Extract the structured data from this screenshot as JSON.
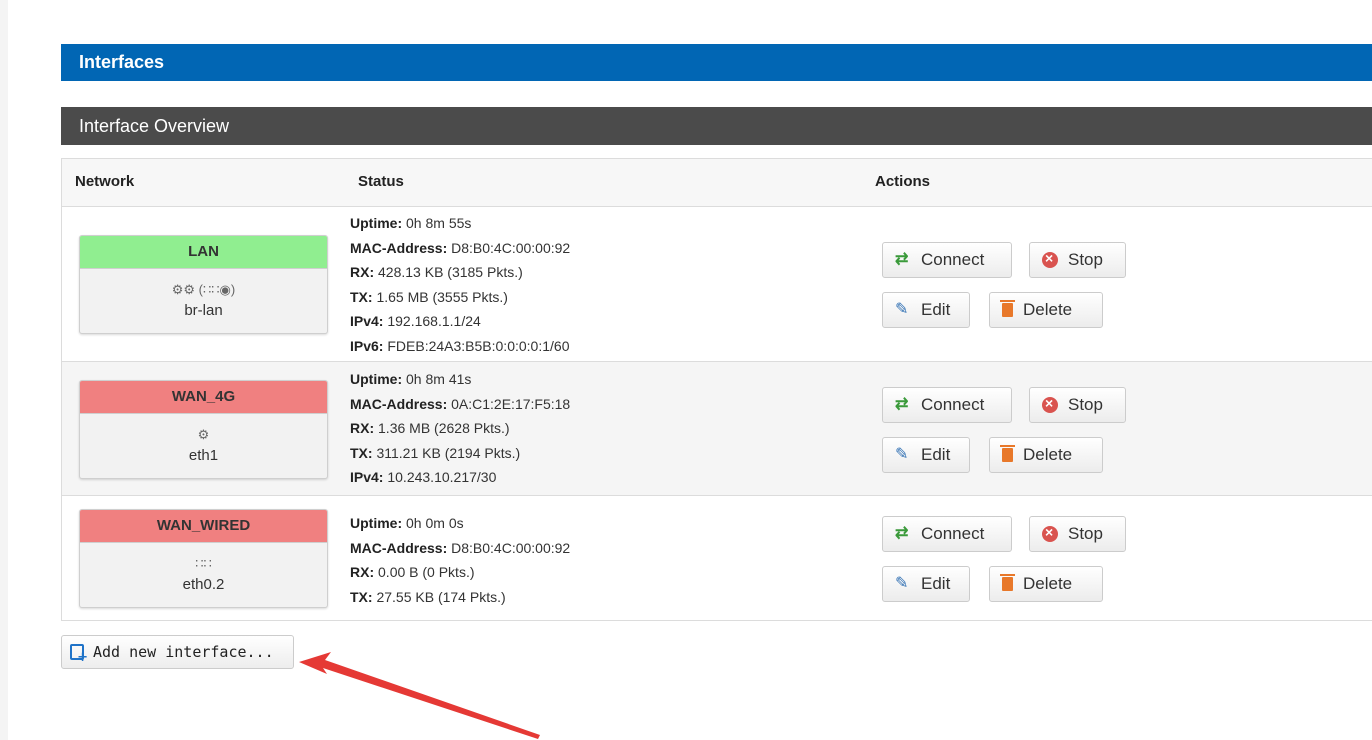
{
  "page": {
    "title": "Interfaces"
  },
  "section": {
    "title": "Interface Overview"
  },
  "table": {
    "headers": {
      "network": "Network",
      "status": "Status",
      "actions": "Actions"
    },
    "rows": [
      {
        "name": "LAN",
        "state": "up",
        "icons": "⚙⚙ (∷∷◉)",
        "device": "br-lan",
        "status": [
          {
            "label": "Uptime:",
            "value": " 0h 8m 55s"
          },
          {
            "label": "MAC-Address:",
            "value": " D8:B0:4C:00:00:92"
          },
          {
            "label": "RX:",
            "value": " 428.13 KB (3185 Pkts.)"
          },
          {
            "label": "TX:",
            "value": " 1.65 MB (3555 Pkts.)"
          },
          {
            "label": "IPv4:",
            "value": " 192.168.1.1/24"
          },
          {
            "label": "IPv6:",
            "value": " FDEB:24A3:B5B:0:0:0:0:1/60"
          }
        ]
      },
      {
        "name": "WAN_4G",
        "state": "down",
        "icons": "⚙",
        "device": "eth1",
        "status": [
          {
            "label": "Uptime:",
            "value": " 0h 8m 41s"
          },
          {
            "label": "MAC-Address:",
            "value": " 0A:C1:2E:17:F5:18"
          },
          {
            "label": "RX:",
            "value": " 1.36 MB (2628 Pkts.)"
          },
          {
            "label": "TX:",
            "value": " 311.21 KB (2194 Pkts.)"
          },
          {
            "label": "IPv4:",
            "value": " 10.243.10.217/30"
          }
        ]
      },
      {
        "name": "WAN_WIRED",
        "state": "down",
        "icons": "∷∷",
        "device": "eth0.2",
        "status": [
          {
            "label": "Uptime:",
            "value": " 0h 0m 0s"
          },
          {
            "label": "MAC-Address:",
            "value": " D8:B0:4C:00:00:92"
          },
          {
            "label": "RX:",
            "value": " 0.00 B (0 Pkts.)"
          },
          {
            "label": "TX:",
            "value": " 27.55 KB (174 Pkts.)"
          }
        ]
      }
    ]
  },
  "actions": {
    "connect": "Connect",
    "stop": "Stop",
    "edit": "Edit",
    "delete": "Delete"
  },
  "add_button": {
    "label": "Add new interface..."
  },
  "colors": {
    "title_bar": "#0166b4",
    "section_bar": "#4b4b4b",
    "up": "#90ee90",
    "down": "#f08080",
    "annotation_arrow": "#e53935"
  },
  "icons": {
    "connect": "refresh-icon",
    "stop": "stop-icon",
    "edit": "edit-icon",
    "delete": "trash-icon",
    "add": "add-page-icon"
  }
}
